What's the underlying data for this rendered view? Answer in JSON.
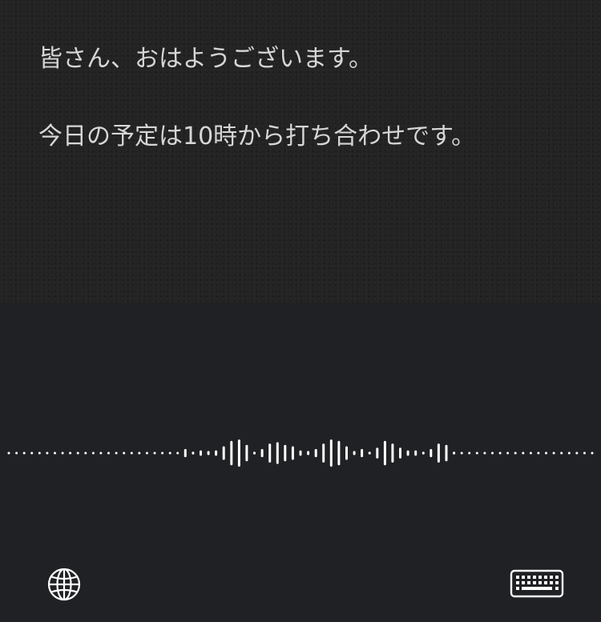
{
  "note": {
    "lines": [
      "皆さん、おはようございます。",
      "今日の予定は10時から打ち合わせです。"
    ]
  },
  "dictation": {
    "waveform_levels": [
      0,
      0,
      0,
      0,
      0,
      0,
      0,
      0,
      0,
      0,
      0,
      0,
      0,
      0,
      0,
      0,
      0,
      0,
      0,
      0,
      0,
      0,
      0,
      0.3,
      0.1,
      0.2,
      0.15,
      0.2,
      0.5,
      0.9,
      1,
      0.6,
      0.1,
      0.3,
      0.7,
      0.8,
      0.6,
      0.5,
      0.2,
      0.15,
      0.3,
      0.7,
      1,
      0.9,
      0.5,
      0.15,
      0.3,
      0.1,
      0.4,
      0.9,
      0.7,
      0.4,
      0.2,
      0.2,
      0.1,
      0.3,
      0.7,
      0.6,
      0.1,
      0,
      0,
      0,
      0,
      0,
      0,
      0,
      0,
      0,
      0,
      0,
      0,
      0,
      0,
      0,
      0,
      0,
      0
    ],
    "icons": {
      "left": "globe-icon",
      "right": "keyboard-icon"
    },
    "colors": {
      "panel": "#202124",
      "wave": "#ffffff"
    }
  }
}
